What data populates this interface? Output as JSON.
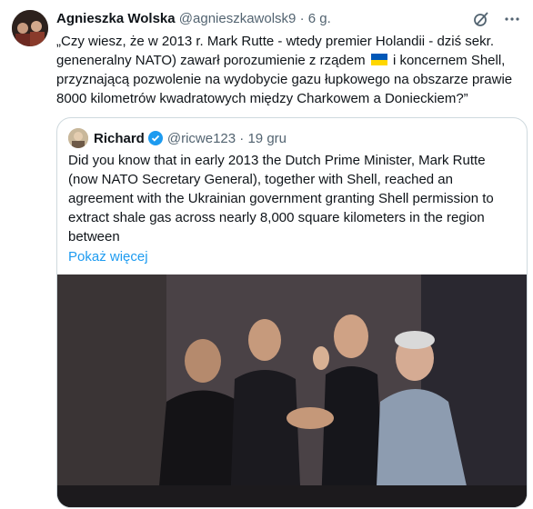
{
  "tweet": {
    "author_name": "Agnieszka Wolska",
    "author_handle": "@agnieszkawolsk9",
    "separator": "·",
    "time": "6 g.",
    "text_line1": "„Czy wiesz, że w 2013 r. Mark Rutte - wtedy premier Holandii - dziś  sekr.",
    "text_line2_a": "geneneralny NATO) zawarł porozumienie z rządem",
    "text_line2_b": "i koncernem Shell,",
    "text_line3": "przyznającą pozwolenie na wydobycie gazu łupkowego na obszarze prawie",
    "text_line4": "8000 kilometrów kwadratowych między Charkowem a Donieckiem?”"
  },
  "quoted": {
    "author_name": "Richard",
    "author_handle": "@ricwe123",
    "separator": "·",
    "time": "19 gru",
    "text_line1": "Did you know that in early 2013 the Dutch Prime Minister, Mark Rutte",
    "text_line2": "(now NATO Secretary General), together with Shell, reached an",
    "text_line3": "agreement with the Ukrainian government granting Shell permission to",
    "text_line4": "extract shale gas across nearly 8,000 square kilometers in the region",
    "text_line5": "between",
    "show_more": "Pokaż więcej"
  },
  "icons": [
    "grok-icon",
    "more-icon",
    "verified-badge-icon",
    "ukraine-flag-icon"
  ],
  "colors": {
    "link": "#1d9bf0",
    "muted": "#536471",
    "border": "#cfd9de",
    "flag_blue": "#0057b7",
    "flag_yellow": "#ffd700"
  }
}
